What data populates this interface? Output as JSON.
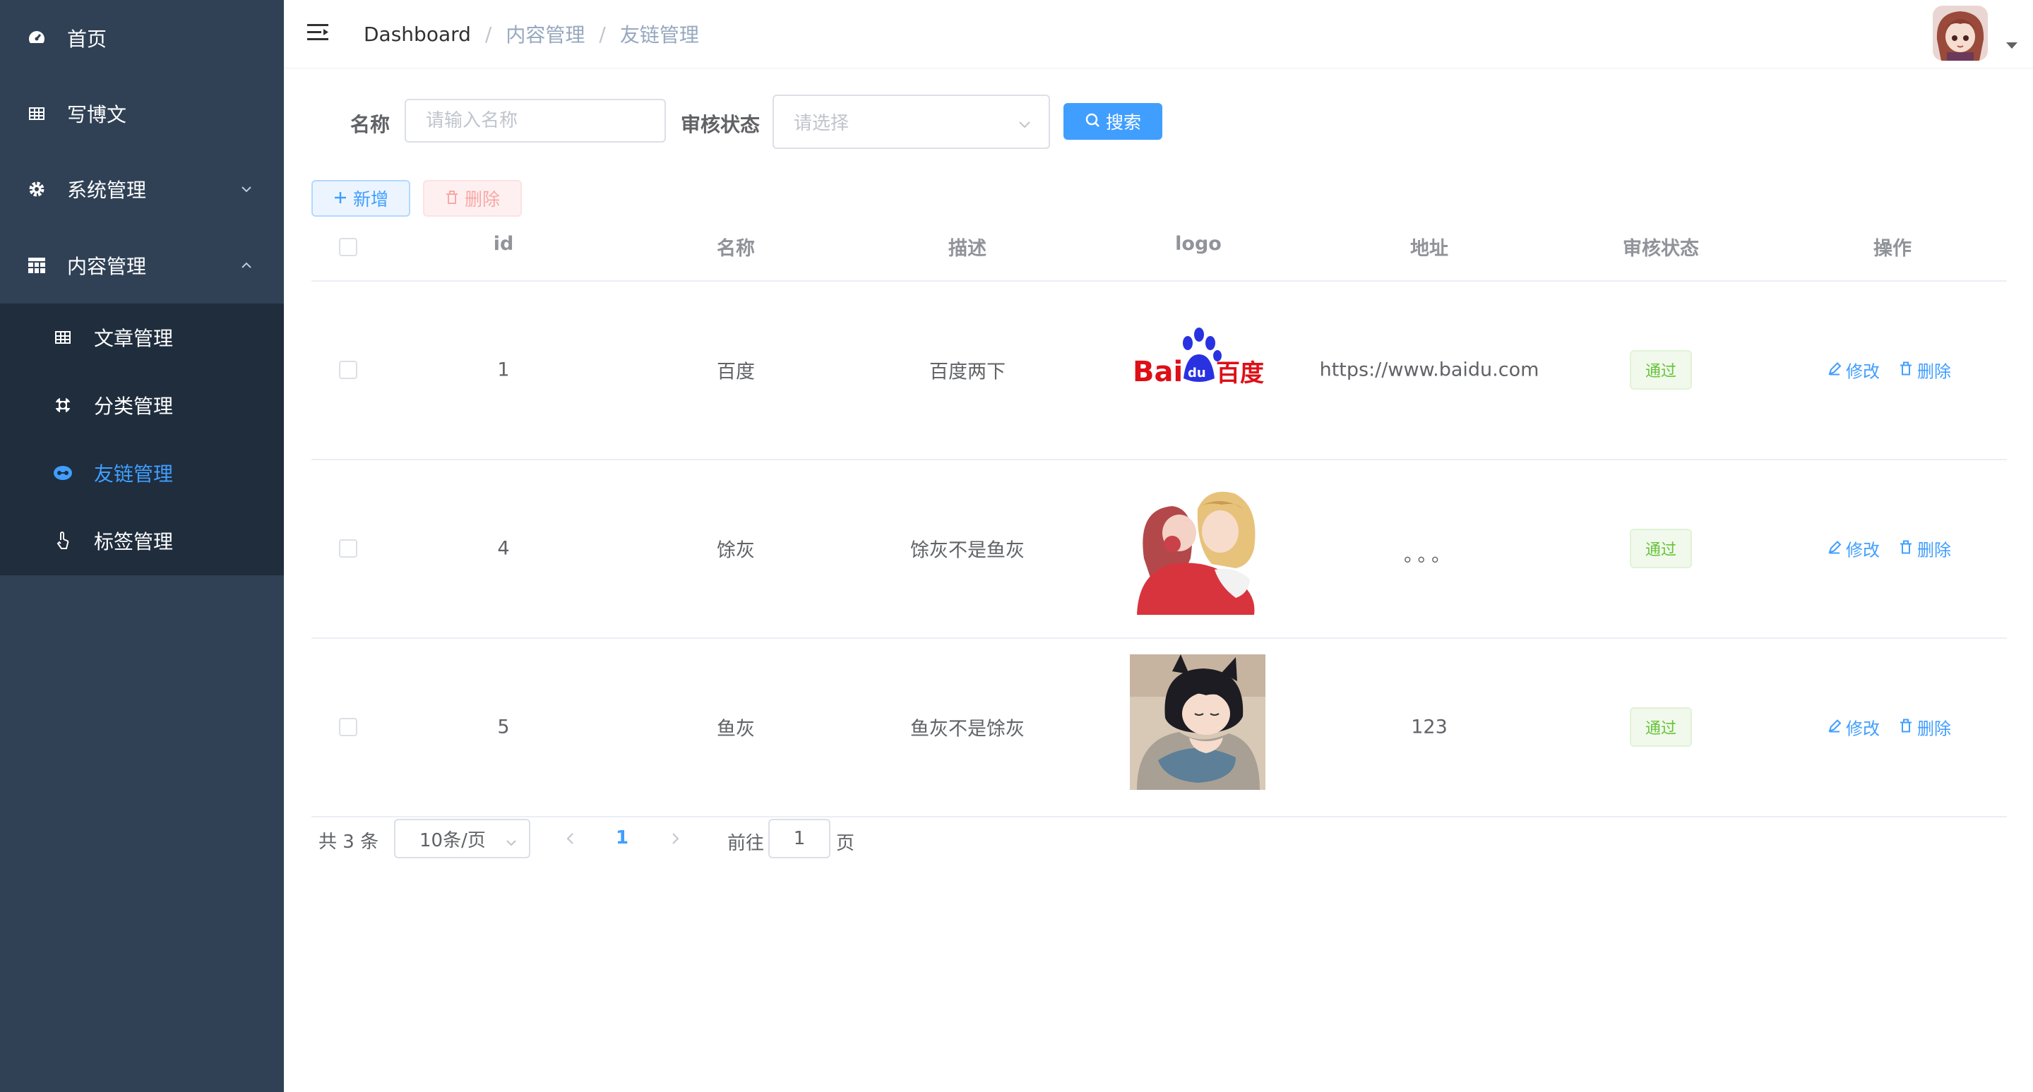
{
  "sidebar": {
    "items": [
      {
        "label": "首页",
        "icon": "dashboard-icon"
      },
      {
        "label": "写博文",
        "icon": "table-icon"
      },
      {
        "label": "系统管理",
        "icon": "gear-icon",
        "expanded": false
      },
      {
        "label": "内容管理",
        "icon": "grid-icon",
        "expanded": true
      }
    ],
    "submenu": [
      {
        "label": "文章管理",
        "icon": "table-icon"
      },
      {
        "label": "分类管理",
        "icon": "component-icon"
      },
      {
        "label": "友链管理",
        "icon": "link-icon",
        "active": true
      },
      {
        "label": "标签管理",
        "icon": "hand-icon"
      }
    ]
  },
  "breadcrumb": {
    "items": [
      "Dashboard",
      "内容管理",
      "友链管理"
    ],
    "separator": "/"
  },
  "filters": {
    "name_label": "名称",
    "name_placeholder": "请输入名称",
    "status_label": "审核状态",
    "status_placeholder": "请选择",
    "search_button": "搜索"
  },
  "toolbar": {
    "add_button": "新增",
    "delete_button": "删除"
  },
  "table": {
    "columns": [
      "id",
      "名称",
      "描述",
      "logo",
      "地址",
      "审核状态",
      "操作"
    ],
    "rows": [
      {
        "id": "1",
        "name": "百度",
        "desc": "百度两下",
        "logo": "baidu-logo",
        "url": "https://www.baidu.com",
        "status": "通过",
        "edit": "修改",
        "delete": "删除"
      },
      {
        "id": "4",
        "name": "馀灰",
        "desc": "馀灰不是鱼灰",
        "logo": "anime-hug-image",
        "url": "。。。",
        "status": "通过",
        "edit": "修改",
        "delete": "删除"
      },
      {
        "id": "5",
        "name": "鱼灰",
        "desc": "鱼灰不是馀灰",
        "logo": "anime-cat-boy-image",
        "url": "123",
        "status": "通过",
        "edit": "修改",
        "delete": "删除"
      }
    ]
  },
  "pagination": {
    "total_text": "共 3 条",
    "page_size": "10条/页",
    "current_page": "1",
    "goto_label": "前往",
    "goto_value": "1",
    "page_unit": "页"
  },
  "colors": {
    "sidebar_bg": "#304156",
    "submenu_bg": "#1f2d3d",
    "primary": "#409eff",
    "success": "#67c23a",
    "danger": "#f56c6c"
  }
}
